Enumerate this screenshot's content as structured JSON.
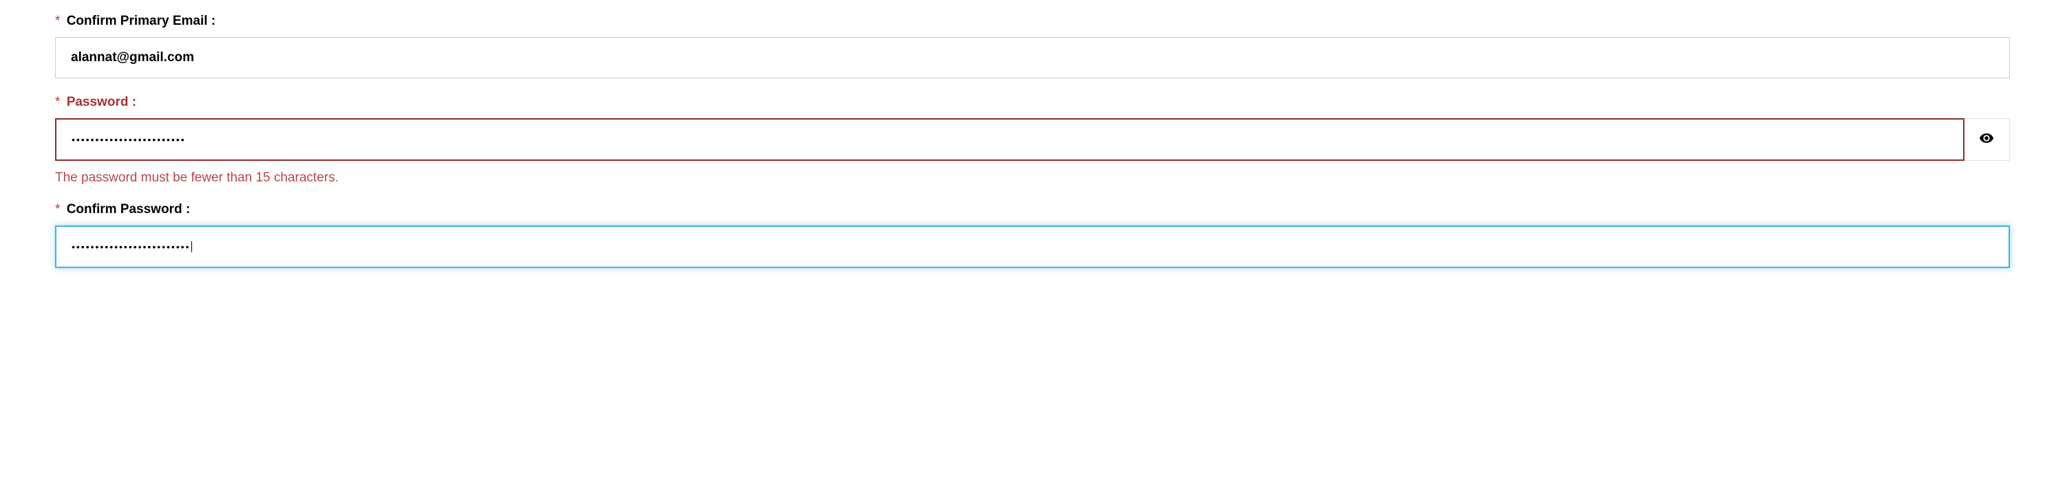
{
  "fields": {
    "confirmEmail": {
      "label": "Confirm Primary Email :",
      "value": "alannat@gmail.com"
    },
    "password": {
      "label": "Password :",
      "maskedValue": "••••••••••••••••••••••••",
      "errorMessage": "The password must be fewer than 15 characters."
    },
    "confirmPassword": {
      "label": "Confirm Password :",
      "maskedValue": "•••••••••••••••••••••••••"
    }
  },
  "requiredMark": "*"
}
